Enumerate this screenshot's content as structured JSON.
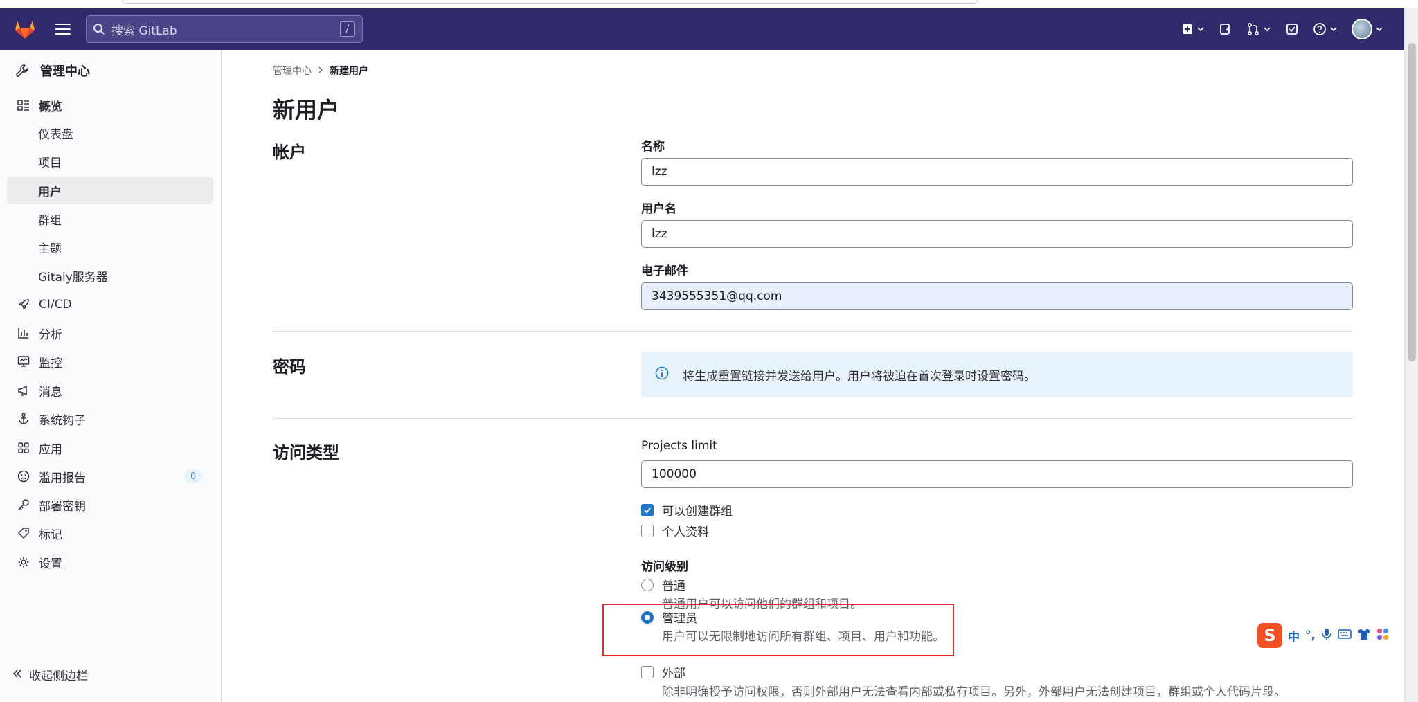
{
  "search": {
    "placeholder": "搜索 GitLab",
    "shortcut": "/"
  },
  "sidebar": {
    "context_title": "管理中心",
    "items": [
      {
        "label": "概览",
        "icon": "overview-icon"
      },
      {
        "label": "仪表盘"
      },
      {
        "label": "项目"
      },
      {
        "label": "用户"
      },
      {
        "label": "群组"
      },
      {
        "label": "主题"
      },
      {
        "label": "Gitaly服务器"
      },
      {
        "label": "CI/CD",
        "icon": "rocket-icon"
      },
      {
        "label": "分析",
        "icon": "chart-icon"
      },
      {
        "label": "监控",
        "icon": "monitor-icon"
      },
      {
        "label": "消息",
        "icon": "bullhorn-icon"
      },
      {
        "label": "系统钩子",
        "icon": "anchor-icon"
      },
      {
        "label": "应用",
        "icon": "apps-icon"
      },
      {
        "label": "滥用报告",
        "icon": "abuse-icon",
        "badge": "0"
      },
      {
        "label": "部署密钥",
        "icon": "key-icon"
      },
      {
        "label": "标记",
        "icon": "label-icon"
      },
      {
        "label": "设置",
        "icon": "settings-icon"
      }
    ],
    "collapse_label": "收起侧边栏"
  },
  "breadcrumb": {
    "parent": "管理中心",
    "current": "新建用户"
  },
  "page": {
    "title": "新用户"
  },
  "account": {
    "section_title": "帐户",
    "name_label": "名称",
    "name_value": "lzz",
    "username_label": "用户名",
    "username_value": "lzz",
    "email_label": "电子邮件",
    "email_value": "3439555351@qq.com"
  },
  "password": {
    "section_title": "密码",
    "info": "将生成重置链接并发送给用户。用户将被迫在首次登录时设置密码。"
  },
  "access": {
    "section_title": "访问类型",
    "projects_limit_label": "Projects limit",
    "projects_limit_value": "100000",
    "can_create_group_label": "可以创建群组",
    "can_create_group_checked": true,
    "private_profile_label": "个人资料",
    "private_profile_checked": false,
    "level_label": "访问级别",
    "levels": [
      {
        "label": "普通",
        "help": "普通用户可以访问他们的群组和项目。",
        "selected": false
      },
      {
        "label": "管理员",
        "help": "用户可以无限制地访问所有群组、项目、用户和功能。",
        "selected": true
      },
      {
        "label": "外部",
        "help": "除非明确授予访问权限，否则外部用户无法查看内部或私有项目。另外，外部用户无法创建项目，群组或个人代码片段。",
        "checked": false
      }
    ]
  },
  "ime": {
    "mode": "中",
    "punct": "°,"
  },
  "colors": {
    "header": "#2f2a6b",
    "accent": "#1f75cb",
    "highlight_box": "#e02a2a"
  }
}
